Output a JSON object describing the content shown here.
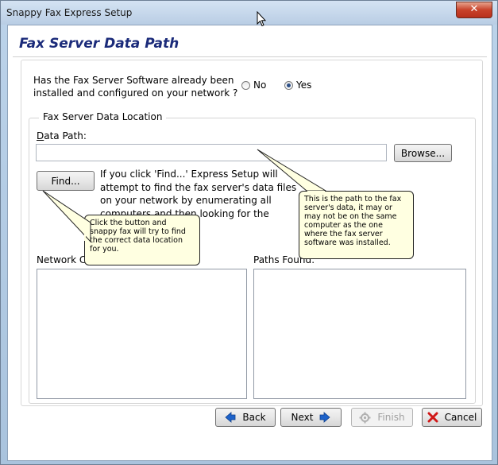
{
  "window": {
    "title": "Snappy Fax Express Setup",
    "close_glyph": "✕"
  },
  "page": {
    "title": "Fax Server Data Path"
  },
  "question": {
    "text": "Has the Fax Server Software already been installed and configured on your network ?",
    "options": [
      {
        "label": "No",
        "selected": false
      },
      {
        "label": "Yes",
        "selected": true
      }
    ]
  },
  "location": {
    "group_label": "Fax Server Data Location",
    "data_path_label": "Data Path:",
    "data_path_value": "",
    "browse_label": "Browse...",
    "find_label": "Find...",
    "find_description": "If you click 'Find...' Express Setup will attempt to find the fax server's data files on your network by enumerating all computers and then looking for the folder with a share",
    "network_computers_label": "Network Computers:",
    "paths_found_label": "Paths Found:"
  },
  "tooltips": {
    "path_tip": "This is the path to the fax server's data, it may or may not be on the same computer as the one where the fax server software was installed.",
    "find_tip": "Click the button and snappy fax will try to find the correct data location for you."
  },
  "nav": {
    "back_label": "Back",
    "next_label": "Next",
    "finish_label": "Finish",
    "cancel_label": "Cancel"
  },
  "colors": {
    "title": "#1b2b7a",
    "arrow": "#1d62c9",
    "cancel_x": "#d01818",
    "tooltip_bg": "#ffffe1"
  }
}
